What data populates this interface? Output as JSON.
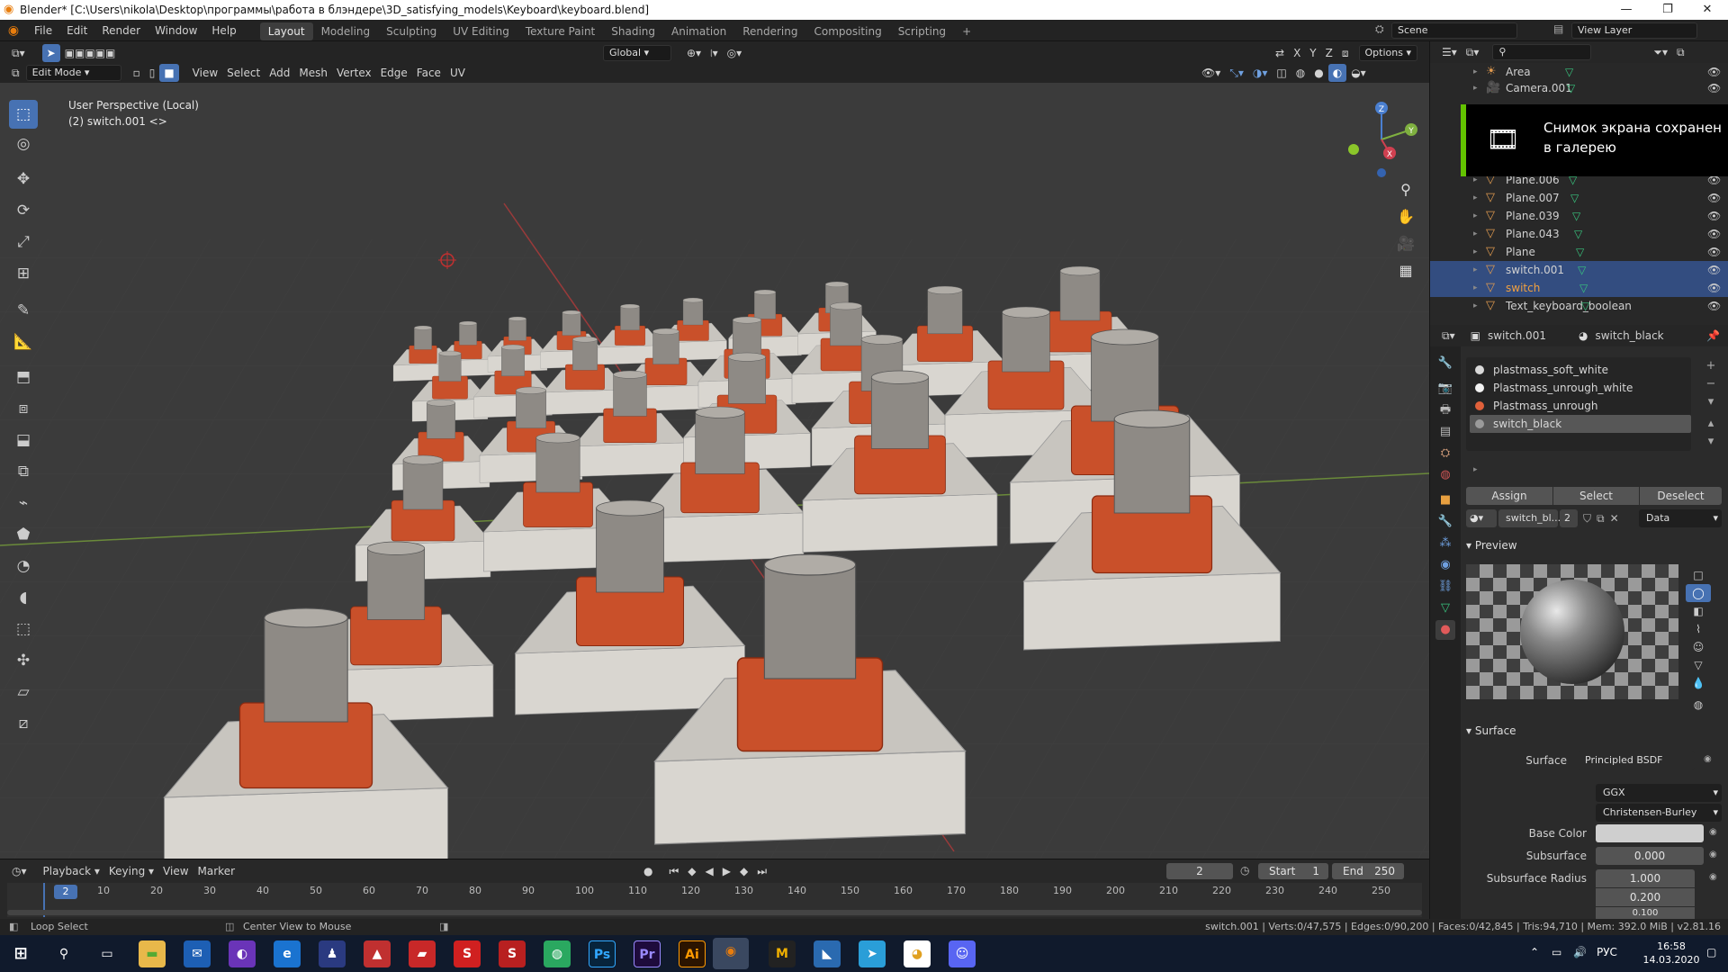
{
  "titlebar": {
    "title": "Blender* [C:\\Users\\nikola\\Desktop\\программы\\работа в блэндере\\3D_satisfying_models\\Keyboard\\keyboard.blend]",
    "minimize": "—",
    "restore": "❐",
    "close": "✕"
  },
  "topbar": {
    "menus": [
      "File",
      "Edit",
      "Render",
      "Window",
      "Help"
    ],
    "workspaces": [
      "Layout",
      "Modeling",
      "Sculpting",
      "UV Editing",
      "Texture Paint",
      "Shading",
      "Animation",
      "Rendering",
      "Compositing",
      "Scripting"
    ],
    "add_tab": "+",
    "scene": "Scene",
    "view_layer": "View Layer"
  },
  "viewport": {
    "mode": "Edit Mode",
    "menus": [
      "View",
      "Select",
      "Add",
      "Mesh",
      "Vertex",
      "Edge",
      "Face",
      "UV"
    ],
    "transform_orientation": "Global",
    "options": "Options",
    "axis_x": "X",
    "axis_y": "Y",
    "axis_z": "Z",
    "overlay_line1": "User Perspective (Local)",
    "overlay_line2": "(2) switch.001 <>",
    "gizmo": {
      "x": "X",
      "y": "Y",
      "z": "Z"
    }
  },
  "tools": [
    "select-box",
    "cursor",
    "move",
    "rotate",
    "scale",
    "transform",
    "annotate",
    "measure",
    "extrude",
    "inset",
    "bevel",
    "loop-cut",
    "knife",
    "poly-build",
    "spin",
    "smooth",
    "edge-slide",
    "shrink-fatten",
    "shear",
    "rip"
  ],
  "outliner": {
    "items": [
      {
        "name": "Area",
        "icon": "light",
        "selected": false
      },
      {
        "name": "Camera.001",
        "icon": "camera",
        "selected": false
      },
      {
        "name": "Plane.006",
        "icon": "mesh",
        "selected": false
      },
      {
        "name": "Plane.007",
        "icon": "mesh",
        "selected": false
      },
      {
        "name": "Plane.039",
        "icon": "mesh",
        "selected": false
      },
      {
        "name": "Plane.043",
        "icon": "mesh",
        "selected": false
      },
      {
        "name": "Plane",
        "icon": "mesh",
        "selected": false
      },
      {
        "name": "switch.001",
        "icon": "mesh",
        "selected": true
      },
      {
        "name": "switch",
        "icon": "mesh",
        "selected": true
      },
      {
        "name": "Text_keyboard_boolean",
        "icon": "mesh",
        "selected": false
      }
    ]
  },
  "toast": {
    "line1": "Снимок экрана сохранен",
    "line2": "в галерею"
  },
  "properties": {
    "object": "switch.001",
    "material": "switch_black",
    "slots": [
      {
        "name": "plastmass_soft_white",
        "color": "#d9d9d9"
      },
      {
        "name": "Plastmass_unrough_white",
        "color": "#f2f2f2"
      },
      {
        "name": "Plastmass_unrough",
        "color": "#e0603a"
      },
      {
        "name": "switch_black",
        "color": "#9a9a9a"
      }
    ],
    "assign": "Assign",
    "select": "Select",
    "deselect": "Deselect",
    "material_field": "switch_bl...",
    "users": "2",
    "link": "Data",
    "preview_label": "Preview",
    "surface_section": "Surface",
    "surface_label": "Surface",
    "surface_value": "Principled BSDF",
    "distribution": "GGX",
    "subsurface_method": "Christensen-Burley",
    "base_color_label": "Base Color",
    "subsurface_label": "Subsurface",
    "subsurface_value": "0.000",
    "subsurface_radius_label": "Subsurface Radius",
    "subsurface_radius": [
      "1.000",
      "0.200",
      "0.100"
    ]
  },
  "timeline": {
    "menus": [
      "Playback",
      "Keying",
      "View",
      "Marker"
    ],
    "current_frame": "2",
    "start_label": "Start",
    "start": "1",
    "end_label": "End",
    "end": "250",
    "ticks": [
      "10",
      "20",
      "30",
      "40",
      "50",
      "60",
      "70",
      "80",
      "90",
      "100",
      "110",
      "120",
      "130",
      "140",
      "150",
      "160",
      "170",
      "180",
      "190",
      "200",
      "210",
      "220",
      "230",
      "240",
      "250"
    ],
    "frame_badge": "2"
  },
  "status": {
    "left1": "Loop Select",
    "left2": "Center View to Mouse",
    "stats": "switch.001 | Verts:0/47,575 | Edges:0/90,200 | Faces:0/42,845 | Tris:94,710 | Mem: 392.0 MiB | v2.81.16"
  },
  "taskbar": {
    "time": "16:58",
    "date": "14.03.2020",
    "lang": "РУС"
  },
  "colors": {
    "accent": "#4772b3",
    "selection": "#334d80",
    "orange": "#d0542c"
  }
}
